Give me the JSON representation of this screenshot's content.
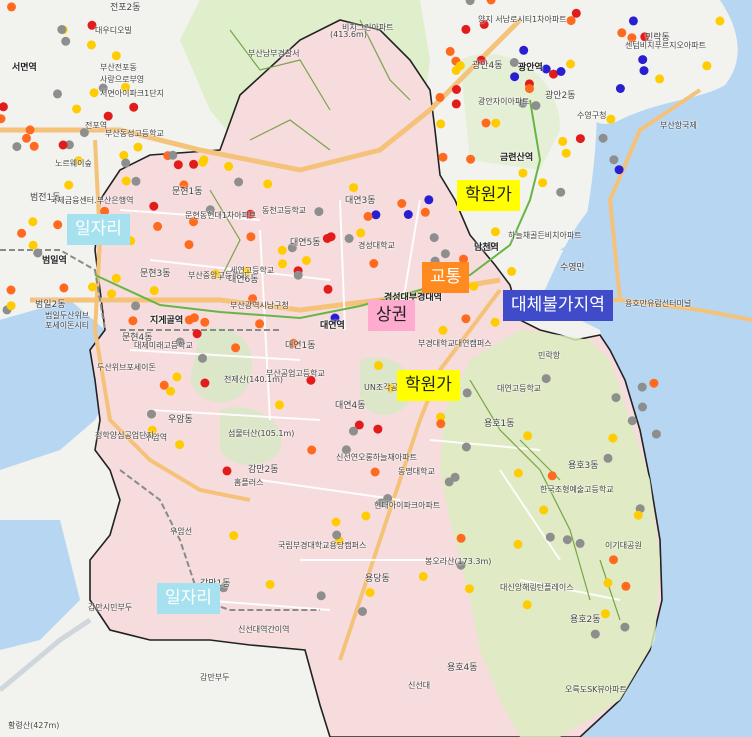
{
  "colors": {
    "sea": "#b6d6f2",
    "land": "#f2f2ee",
    "park": "#dfeecb",
    "district": "#f6dcdd",
    "road_major": "#f5c27a",
    "road": "#ffffff",
    "rail": "#8a8a8a",
    "boundary": "#222222",
    "dot_gray": "#8e8e8e",
    "dot_yellow": "#ffcc00",
    "dot_orange": "#ff6a1f",
    "dot_red": "#e21b1b",
    "dot_blue": "#2a1fd0"
  },
  "badges": [
    {
      "name": "badge-hagwon-north",
      "text": "학원가",
      "bg": "#ffff00",
      "color": "#222222"
    },
    {
      "name": "badge-jobs-west",
      "text": "일자리",
      "bg": "#a6e1f0",
      "color": "#ffffff"
    },
    {
      "name": "badge-transport",
      "text": "교통",
      "bg": "#ff8a1f",
      "color": "#ffffff"
    },
    {
      "name": "badge-commercial",
      "text": "상권",
      "bg": "#ffaacf",
      "color": "#222222"
    },
    {
      "name": "badge-irreplaceable",
      "text": "대체불가지역",
      "bg": "#3f4bc8",
      "color": "#ffffff"
    },
    {
      "name": "badge-hagwon-central",
      "text": "학원가",
      "bg": "#ffff00",
      "color": "#222222"
    },
    {
      "name": "badge-jobs-south",
      "text": "일자리",
      "bg": "#a6e1f0",
      "color": "#ffffff"
    }
  ],
  "map_labels": [
    {
      "name": "label-seomyeon-station",
      "text": "서면역",
      "style": "bold"
    },
    {
      "name": "label-jeonpo2",
      "text": "전포2동",
      "style": ""
    },
    {
      "name": "label-daeudiwol",
      "text": "대우디오빌",
      "style": "sm"
    },
    {
      "name": "label-busan-jeonpo",
      "text": "부산전포동",
      "style": "sm"
    },
    {
      "name": "label-saranghaeyo",
      "text": "사랑으로부영",
      "style": "sm"
    },
    {
      "name": "label-seomyeon-apt",
      "text": "서면아이파크1단지",
      "style": "sm"
    },
    {
      "name": "label-beomjeon",
      "text": "범전1동",
      "style": ""
    },
    {
      "name": "label-jeonpo-st",
      "text": "전포역",
      "style": "sm"
    },
    {
      "name": "label-busan-dongseong",
      "text": "부산동성고등학교",
      "style": "sm"
    },
    {
      "name": "label-norepark",
      "text": "노르웨이숲",
      "style": "sm"
    },
    {
      "name": "label-bifc",
      "text": "국제금융센터.부산은행역",
      "style": "sm"
    },
    {
      "name": "label-beomil-st",
      "text": "범일역",
      "style": "bold"
    },
    {
      "name": "label-beomil2",
      "text": "범일2동",
      "style": ""
    },
    {
      "name": "label-beomil-doosan",
      "text": "범일두산위브",
      "style": "sm"
    },
    {
      "name": "label-posco",
      "text": "포세이돈시티",
      "style": "sm"
    },
    {
      "name": "label-munhyeon1",
      "text": "문현1동",
      "style": ""
    },
    {
      "name": "label-munhyeon-hyundai",
      "text": "문현동현대1차아파트",
      "style": "sm"
    },
    {
      "name": "label-munhyeon3",
      "text": "문현3동",
      "style": ""
    },
    {
      "name": "label-munhyeon4",
      "text": "문현4동",
      "style": ""
    },
    {
      "name": "label-jigegol",
      "text": "지게골역",
      "style": "bold"
    },
    {
      "name": "label-busan-jungang",
      "text": "부산중앙고등학교",
      "style": "sm"
    },
    {
      "name": "label-daeyeon6",
      "text": "대연6동",
      "style": ""
    },
    {
      "name": "label-seyeon",
      "text": "세연고등학교",
      "style": "sm"
    },
    {
      "name": "label-busan-yesul",
      "text": "부산광역시남구청",
      "style": "sm"
    },
    {
      "name": "label-daeyeon5",
      "text": "대연5동",
      "style": ""
    },
    {
      "name": "label-daeyeon3",
      "text": "대연3동",
      "style": ""
    },
    {
      "name": "label-dongcheon",
      "text": "동천고등학교",
      "style": "sm"
    },
    {
      "name": "label-kyungsung",
      "text": "경성대학교",
      "style": "sm"
    },
    {
      "name": "label-daeyeon-st",
      "text": "대연역",
      "style": "bold"
    },
    {
      "name": "label-kyungsung-st",
      "text": "경성대부경대역",
      "style": "bold"
    },
    {
      "name": "label-daeyeon1",
      "text": "대연1동",
      "style": ""
    },
    {
      "name": "label-daeyeon4",
      "text": "대연4동",
      "style": ""
    },
    {
      "name": "label-cheonjesan",
      "text": "천제산(140.1m)",
      "style": "sm"
    },
    {
      "name": "label-busan-gongeop",
      "text": "부산공업고등학교",
      "style": "sm"
    },
    {
      "name": "label-uam",
      "text": "우암동",
      "style": ""
    },
    {
      "name": "label-uam-st",
      "text": "우암역",
      "style": "sm"
    },
    {
      "name": "label-sinsan",
      "text": "섬물터산(105.1m)",
      "style": "sm"
    },
    {
      "name": "label-gamman2",
      "text": "감만2동",
      "style": ""
    },
    {
      "name": "label-homeplus",
      "text": "홈플러스",
      "style": "sm"
    },
    {
      "name": "label-un",
      "text": "UN조각공원",
      "style": "sm"
    },
    {
      "name": "label-pknu",
      "text": "부경대학교대연캠퍼스",
      "style": "sm"
    },
    {
      "name": "label-dongmyung",
      "text": "동명대학교",
      "style": "sm"
    },
    {
      "name": "label-sinseon",
      "text": "신선연오롱하늘채아파트",
      "style": "sm"
    },
    {
      "name": "label-yongho1",
      "text": "용호1동",
      "style": ""
    },
    {
      "name": "label-yongho3",
      "text": "용호3동",
      "style": ""
    },
    {
      "name": "label-yongho2",
      "text": "용호2동",
      "style": ""
    },
    {
      "name": "label-yongho4",
      "text": "용호4동",
      "style": ""
    },
    {
      "name": "label-yongdang",
      "text": "용당동",
      "style": ""
    },
    {
      "name": "label-gamman1",
      "text": "감만1동",
      "style": ""
    },
    {
      "name": "label-pknu-yongdang",
      "text": "국립부경대학교용당캠퍼스",
      "style": "sm"
    },
    {
      "name": "label-hyundai-ipark",
      "text": "현대아이파크아파트",
      "style": "sm"
    },
    {
      "name": "label-bonghwasan",
      "text": "봉오라산(173.3m)",
      "style": "sm"
    },
    {
      "name": "label-daesin-haeryu",
      "text": "대신앙해링턴플레이스",
      "style": "sm"
    },
    {
      "name": "label-korea-art",
      "text": "한국조형예술고등학교",
      "style": "sm"
    },
    {
      "name": "label-igidae",
      "text": "이기대공원",
      "style": "sm"
    },
    {
      "name": "label-gamman-pier",
      "text": "감만시민부두",
      "style": "sm"
    },
    {
      "name": "label-sinseondae",
      "text": "신선대역간이역",
      "style": "sm"
    },
    {
      "name": "label-uam-line",
      "text": "우암선",
      "style": "sm"
    },
    {
      "name": "label-gamman-pier2",
      "text": "감만부두",
      "style": "sm"
    },
    {
      "name": "label-sinseondae-park",
      "text": "신선대",
      "style": "sm"
    },
    {
      "name": "label-oryukdo",
      "text": "오륙도SK뷰아파트",
      "style": "sm"
    },
    {
      "name": "label-gwangan4",
      "text": "광안4동",
      "style": ""
    },
    {
      "name": "label-gwangan-st",
      "text": "광안역",
      "style": "bold"
    },
    {
      "name": "label-gwangan2",
      "text": "광안2동",
      "style": ""
    },
    {
      "name": "label-minrak",
      "text": "민락동",
      "style": ""
    },
    {
      "name": "label-centum",
      "text": "센텀비치푸르지오아파트",
      "style": "sm"
    },
    {
      "name": "label-gwangan-apt",
      "text": "광안자이아파트",
      "style": "sm"
    },
    {
      "name": "label-suyeong",
      "text": "수영구청",
      "style": "sm"
    },
    {
      "name": "label-geumnyeonsan",
      "text": "금련산역",
      "style": "bold"
    },
    {
      "name": "label-namcheon-st",
      "text": "남천역",
      "style": "bold"
    },
    {
      "name": "label-haneul",
      "text": "하늘채골든비치아파트",
      "style": "sm"
    },
    {
      "name": "label-suyeongman",
      "text": "수영만",
      "style": ""
    },
    {
      "name": "label-yongho-terminal",
      "text": "용호만유람선터미널",
      "style": "sm"
    },
    {
      "name": "label-minrak-port",
      "text": "민락항",
      "style": "sm"
    },
    {
      "name": "label-busan-port",
      "text": "부산항국제",
      "style": "sm"
    },
    {
      "name": "label-cheonghak",
      "text": "청학양심공업단지",
      "style": "sm"
    },
    {
      "name": "label-hwangnyeong",
      "text": "황령산(427m)",
      "style": "sm"
    },
    {
      "name": "label-busan-nambu",
      "text": "부산남부경찰서",
      "style": "sm"
    },
    {
      "name": "label-jeonpo-tunnel",
      "text": "(413.6m)",
      "style": "sm"
    },
    {
      "name": "label-bitgyo",
      "text": "비치그린아파트",
      "style": "sm"
    },
    {
      "name": "label-seongjil",
      "text": "양지 서남로시티1차아파트",
      "style": "sm"
    },
    {
      "name": "label-daeyeon-high",
      "text": "대연고등학교",
      "style": "sm"
    },
    {
      "name": "label-daejemidae",
      "text": "대제미래고등학교",
      "style": "sm"
    },
    {
      "name": "label-2sin",
      "text": "두산위브포세이돈",
      "style": "sm"
    }
  ]
}
